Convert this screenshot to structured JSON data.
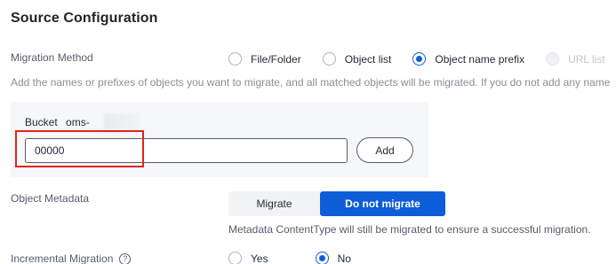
{
  "section_title": "Source Configuration",
  "migration_method": {
    "label": "Migration Method",
    "options": [
      {
        "label": "File/Folder",
        "checked": false,
        "disabled": false
      },
      {
        "label": "Object list",
        "checked": false,
        "disabled": false
      },
      {
        "label": "Object name prefix",
        "checked": true,
        "disabled": false
      },
      {
        "label": "URL list",
        "checked": false,
        "disabled": true
      }
    ]
  },
  "description": "Add the names or prefixes of objects you want to migrate, and all matched objects will be migrated. If you do not add any name",
  "bucket": {
    "label": "Bucket",
    "name": "oms-"
  },
  "prefix_input": {
    "value": "00000"
  },
  "add_button_label": "Add",
  "object_metadata": {
    "label": "Object Metadata",
    "options": [
      "Migrate",
      "Do not migrate"
    ],
    "selected": "Do not migrate",
    "note": "Metadata ContentType will still be migrated to ensure a successful migration."
  },
  "incremental_migration": {
    "label": "Incremental Migration",
    "help_icon": "?",
    "options": [
      {
        "label": "Yes",
        "checked": false
      },
      {
        "label": "No",
        "checked": true
      }
    ]
  },
  "colors": {
    "accent": "#0e5dd8",
    "highlight": "#e1231a",
    "panel": "#f6f7f9"
  }
}
